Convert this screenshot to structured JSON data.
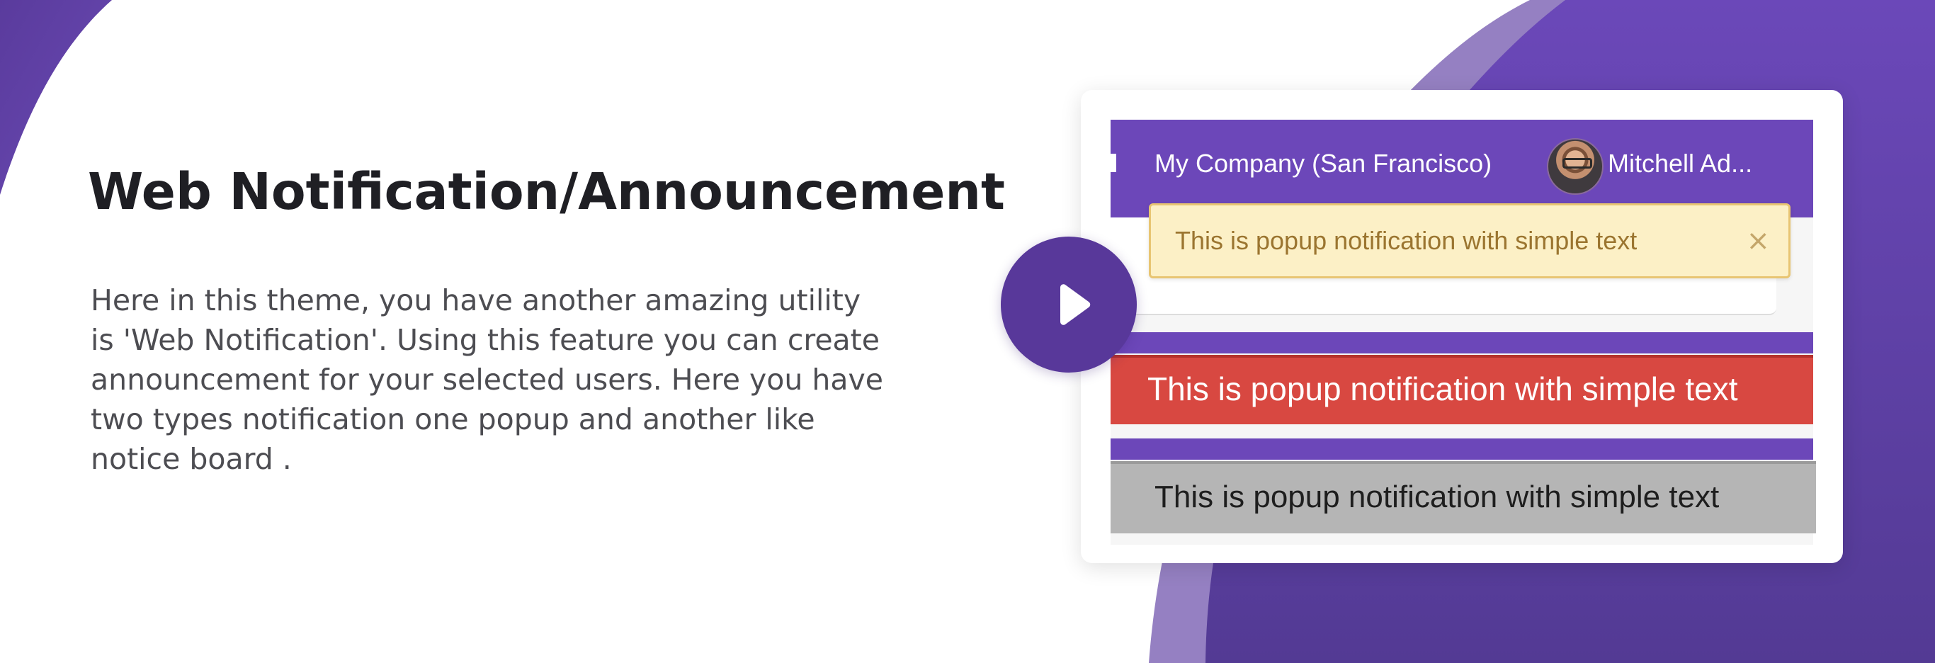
{
  "colors": {
    "brand_purple": "#6c47b9",
    "play_button": "#58389a",
    "title_text": "#1f1f24",
    "body_text": "#4d4d52",
    "popup_yellow_bg": "#fcf0c6",
    "popup_yellow_text": "#9b7530",
    "bar_red": "#d84841",
    "bar_grey": "#b5b5b5"
  },
  "hero": {
    "title": "Web Notification/Announcement",
    "description_lines": [
      "Here in this theme, you have another amazing utility",
      "is 'Web Notification'. Using this feature you can create",
      "announcement for your selected users. Here you have",
      "two types notification one popup and another like",
      "notice board ."
    ]
  },
  "video": {
    "play_icon": "play-icon"
  },
  "preview": {
    "company_label": "My Company (San Francisco)",
    "user_label": "Mitchell Ad...",
    "avatar_icon": "user-avatar",
    "popup_text": "This is popup notification with simple text",
    "popup_close": "×",
    "red_bar_text": "This is popup notification with simple text",
    "grey_bar_text": "This is popup notification with simple text"
  }
}
